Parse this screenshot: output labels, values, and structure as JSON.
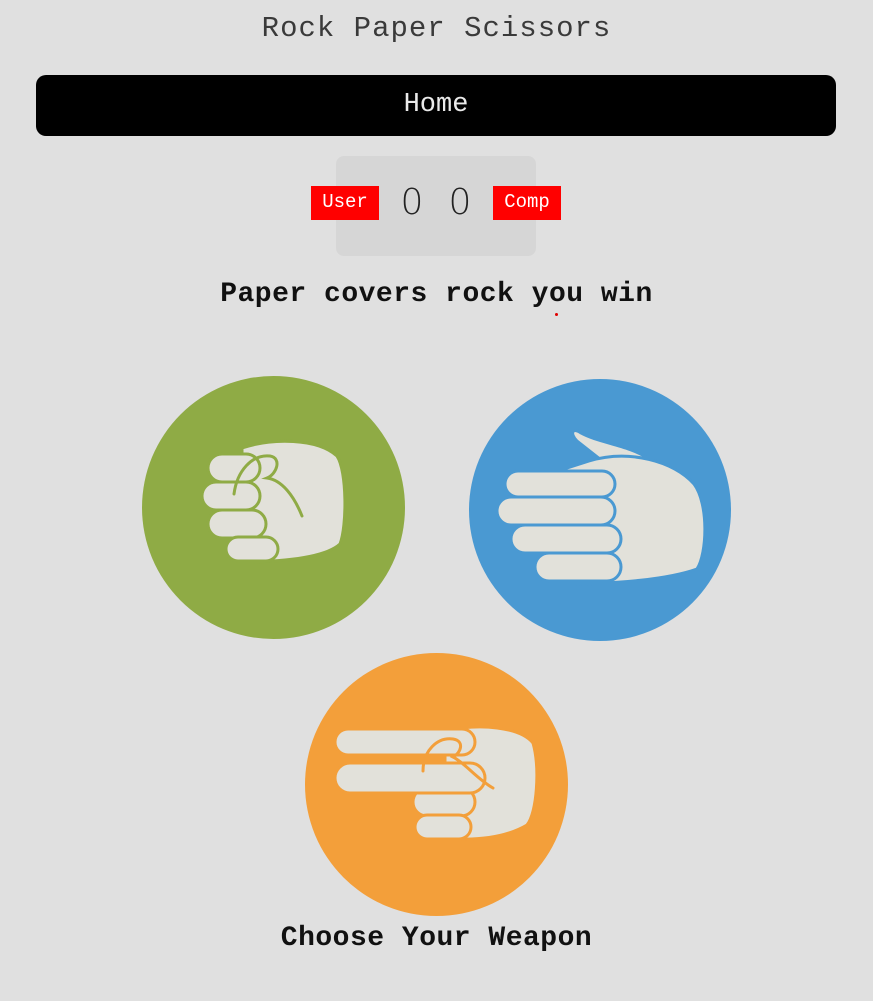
{
  "header": {
    "title": "Rock Paper Scissors",
    "home_label": "Home"
  },
  "scoreboard": {
    "user_label": "User",
    "comp_label": "Comp",
    "user_score": "0",
    "comp_score": "0"
  },
  "result_message": "Paper covers rock you win",
  "weapons": [
    {
      "name": "rock",
      "icon": "fist-icon",
      "color": "#8fab45"
    },
    {
      "name": "paper",
      "icon": "open-hand-icon",
      "color": "#4a99d2"
    },
    {
      "name": "scissors",
      "icon": "scissors-hand-icon",
      "color": "#f39f3a"
    }
  ],
  "footer": {
    "prompt": "Choose Your Weapon"
  },
  "colors": {
    "background": "#e0e0e0",
    "badge": "#ff0000",
    "home_button": "#000000",
    "hand": "#e2e1da"
  }
}
